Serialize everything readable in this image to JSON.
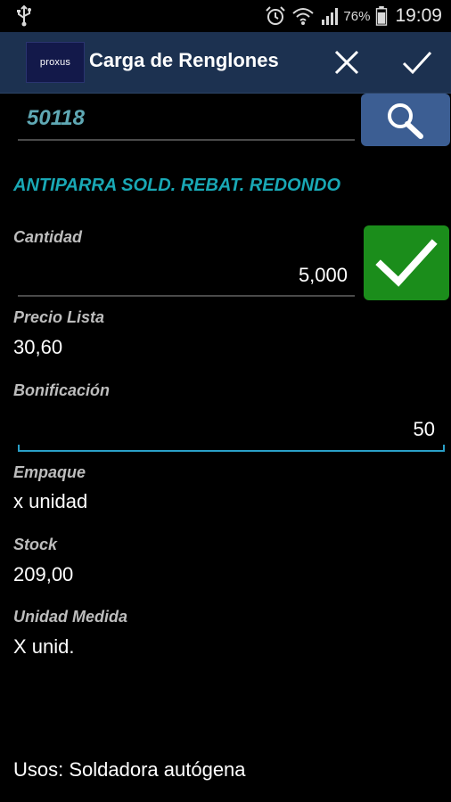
{
  "status_bar": {
    "battery_percent": "76%",
    "time": "19:09",
    "icons": [
      "usb-icon",
      "alarm-icon",
      "wifi-icon",
      "signal-icon",
      "battery-icon"
    ]
  },
  "action_bar": {
    "logo_text": "proxus",
    "title": "Carga de Renglones",
    "close_icon": "close-icon",
    "confirm_icon": "checkmark-icon"
  },
  "search": {
    "code_value": "50118",
    "search_icon": "search-icon"
  },
  "product": {
    "description": "ANTIPARRA  SOLD. REBAT. REDONDO"
  },
  "fields": {
    "cantidad_label": "Cantidad",
    "cantidad_value": "5,000",
    "precio_lista_label": "Precio Lista",
    "precio_lista_value": "30,60",
    "bonificacion_label": "Bonificación",
    "bonificacion_value": "50",
    "empaque_label": "Empaque",
    "empaque_value": "x unidad",
    "stock_label": "Stock",
    "stock_value": "209,00",
    "unidad_medida_label": "Unidad Medida",
    "unidad_medida_value": "X unid."
  },
  "footer": {
    "usos": "Usos: Soldadora autógena"
  },
  "colors": {
    "action_bar": "#1c3150",
    "search_button": "#3c5e93",
    "ok_button": "#1b8d1b",
    "accent_text": "#19a8b5",
    "code_text": "#5fa8b4",
    "focus_underline": "#2aa0c8"
  }
}
